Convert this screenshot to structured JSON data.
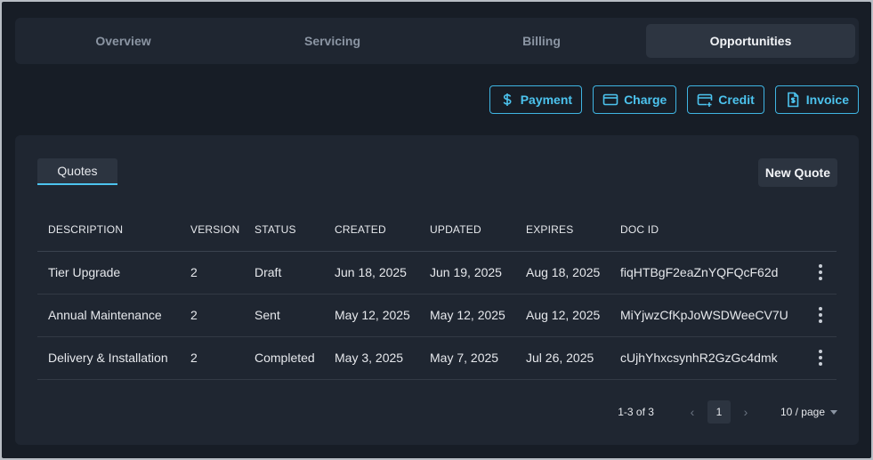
{
  "tabs": [
    {
      "label": "Overview",
      "active": false
    },
    {
      "label": "Servicing",
      "active": false
    },
    {
      "label": "Billing",
      "active": false
    },
    {
      "label": "Opportunities",
      "active": true
    }
  ],
  "actions": {
    "payment": {
      "label": "Payment",
      "icon": "dollar-icon"
    },
    "charge": {
      "label": "Charge",
      "icon": "card-icon"
    },
    "credit": {
      "label": "Credit",
      "icon": "card-plus-icon"
    },
    "invoice": {
      "label": "Invoice",
      "icon": "invoice-icon"
    }
  },
  "quotes": {
    "subtab_label": "Quotes",
    "new_quote_label": "New Quote",
    "columns": [
      "DESCRIPTION",
      "VERSION",
      "STATUS",
      "CREATED",
      "UPDATED",
      "EXPIRES",
      "DOC ID"
    ],
    "rows": [
      {
        "description": "Tier Upgrade",
        "version": "2",
        "status": "Draft",
        "created": "Jun 18, 2025",
        "updated": "Jun 19, 2025",
        "expires": "Aug 18, 2025",
        "doc_id": "fiqHTBgF2eaZnYQFQcF62d"
      },
      {
        "description": "Annual Maintenance",
        "version": "2",
        "status": "Sent",
        "created": "May 12, 2025",
        "updated": "May 12, 2025",
        "expires": "Aug 12, 2025",
        "doc_id": "MiYjwzCfKpJoWSDWeeCV7U"
      },
      {
        "description": "Delivery & Installation",
        "version": "2",
        "status": "Completed",
        "created": "May 3, 2025",
        "updated": "May 7, 2025",
        "expires": "Jul 26, 2025",
        "doc_id": "cUjhYhxcsynhR2GzGc4dmk"
      }
    ]
  },
  "pagination": {
    "range_text": "1-3 of 3",
    "current_page": "1",
    "page_size": "10 / page"
  },
  "colors": {
    "accent": "#4cc3ee",
    "background": "#171d26",
    "panel": "#1f2631"
  }
}
